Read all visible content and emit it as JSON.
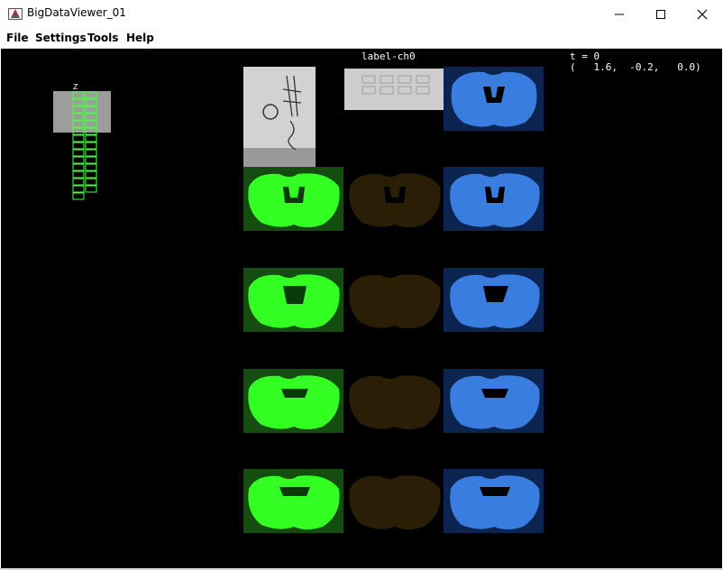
{
  "window": {
    "title": "BigDataViewer_01",
    "controls": [
      "minimize",
      "maximize",
      "close"
    ]
  },
  "menu": {
    "items": [
      "File",
      "Settings",
      "Tools",
      "Help"
    ]
  },
  "viewer": {
    "source_label": "label-ch0",
    "timepoint_text": "t = 0",
    "coordinates_text": "(   1.6,  -0.2,   0.0)",
    "navigator_axis_label": "Z"
  },
  "colors": {
    "viewer_background": "#000000",
    "green_channel": "#33ff22",
    "amber_channel": "#8a6418",
    "blue_channel": "#3a7de0",
    "navigator_box": "#44ff44"
  }
}
